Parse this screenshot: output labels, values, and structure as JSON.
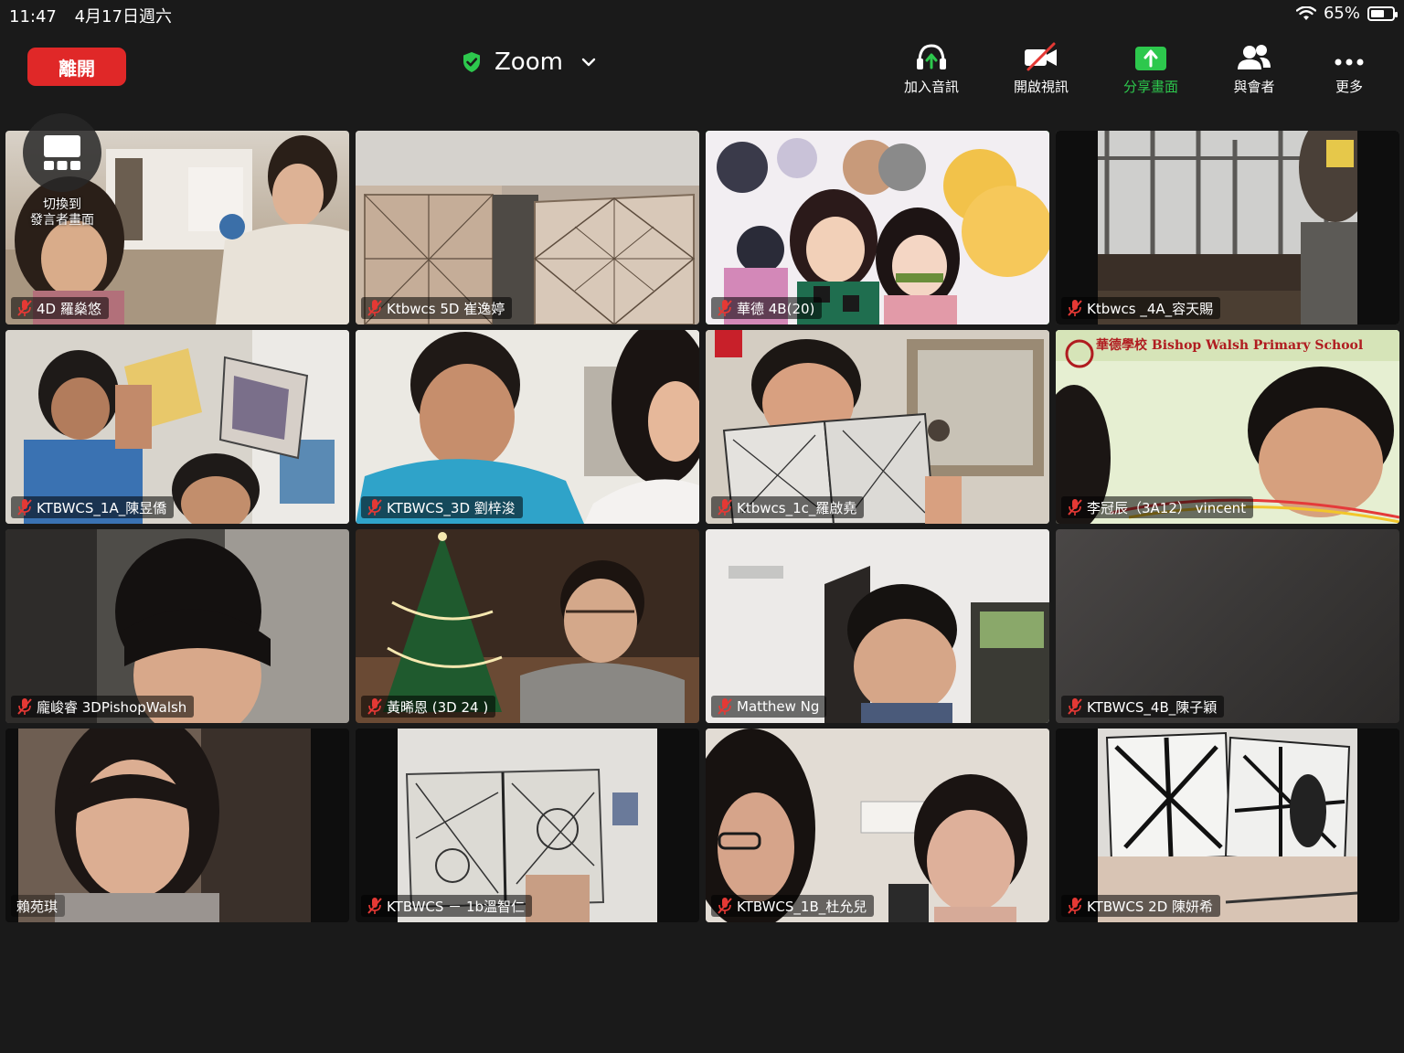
{
  "status": {
    "time": "11:47",
    "date": "4月17日週六",
    "battery": "65%",
    "battery_level": 0.65
  },
  "toolbar": {
    "leave_label": "離開",
    "meeting_title": "Zoom",
    "join_audio_label": "加入音訊",
    "start_video_label": "開啟視訊",
    "share_screen_label": "分享畫面",
    "participants_label": "與會者",
    "more_label": "更多"
  },
  "switch_view": {
    "label_line1": "切換到",
    "label_line2": "發言者畫面"
  },
  "participants": [
    {
      "name": "4D 羅燊悠",
      "muted": true,
      "scene": "home-kitchen"
    },
    {
      "name": "Ktbwcs 5D 崔逸婷",
      "muted": true,
      "scene": "zentangle-cards"
    },
    {
      "name": "華德 4B(20)",
      "muted": true,
      "scene": "anime-background",
      "active": true
    },
    {
      "name": "Ktbwcs _4A_容天賜",
      "muted": true,
      "scene": "window-room"
    },
    {
      "name": "KTBWCS_1A_陳昱僑",
      "muted": true,
      "scene": "kids-with-card"
    },
    {
      "name": "KTBWCS_3D 劉梓浚",
      "muted": true,
      "scene": "boy-and-mother"
    },
    {
      "name": "Ktbwcs_1c_羅啟堯",
      "muted": true,
      "scene": "boy-with-book"
    },
    {
      "name": "李冠辰（3A12） vincent",
      "muted": true,
      "scene": "school-banner",
      "banner_text": "華德學校 Bishop Walsh Primary School"
    },
    {
      "name": "龐峻睿 3DPishopWalsh",
      "muted": true,
      "scene": "car-seat"
    },
    {
      "name": "黃晞恩 (3D 24 )",
      "muted": true,
      "scene": "christmas-tree"
    },
    {
      "name": "Matthew Ng",
      "muted": true,
      "scene": "boy-at-wall"
    },
    {
      "name": "KTBWCS_4B_陳子穎",
      "muted": true,
      "scene": "dark-blur"
    },
    {
      "name": "賴苑琪",
      "muted": false,
      "scene": "girl-closeup"
    },
    {
      "name": "KTBWCS － 1b溫智仁",
      "muted": true,
      "scene": "zentangle-book"
    },
    {
      "name": "KTBWCS_1B_杜允兒",
      "muted": true,
      "scene": "girl-and-mother"
    },
    {
      "name": "KTBWCS 2D 陳妍希",
      "muted": true,
      "scene": "zentangle-tiles"
    }
  ],
  "colors": {
    "leave": "#e02828",
    "share": "#2dc84d",
    "active_border": "#22c03a",
    "shield": "#2dc84d",
    "mute": "#e53935"
  }
}
